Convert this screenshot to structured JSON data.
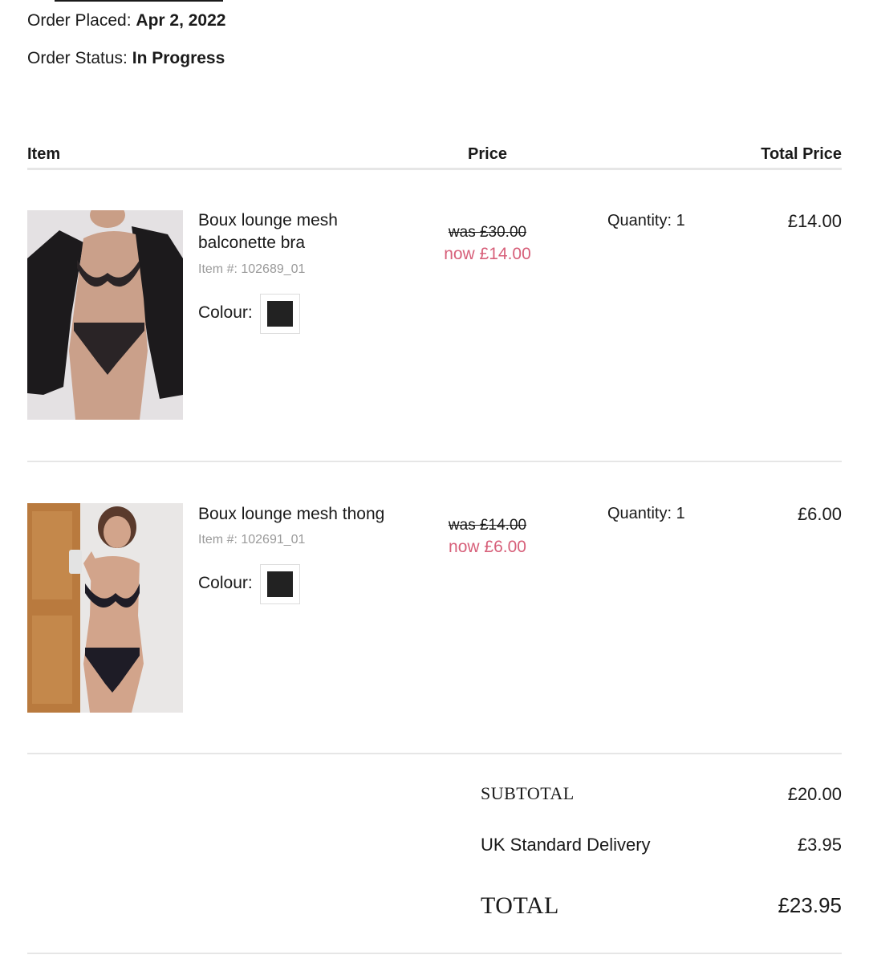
{
  "order": {
    "placed_label": "Order Placed:",
    "placed_value": "Apr 2, 2022",
    "status_label": "Order Status:",
    "status_value": "In Progress"
  },
  "table_header": {
    "item": "Item",
    "price": "Price",
    "total_price": "Total Price"
  },
  "items": [
    {
      "name": "Boux lounge mesh balconette bra",
      "item_number": "Item #: 102689_01",
      "colour_label": "Colour:",
      "colour_swatch": "#222222",
      "was_price": "was £30.00",
      "now_price": "now £14.00",
      "quantity": "Quantity: 1",
      "total": "£14.00"
    },
    {
      "name": "Boux lounge mesh thong",
      "item_number": "Item #: 102691_01",
      "colour_label": "Colour:",
      "colour_swatch": "#222222",
      "was_price": "was £14.00",
      "now_price": "now £6.00",
      "quantity": "Quantity: 1",
      "total": "£6.00"
    }
  ],
  "summary": {
    "subtotal_label": "SUBTOTAL",
    "subtotal_value": "£20.00",
    "delivery_label": "UK Standard Delivery",
    "delivery_value": "£3.95",
    "total_label": "TOTAL",
    "total_value": "£23.95"
  },
  "colors": {
    "sale_price": "#d7607a",
    "divider": "#e6e6e6",
    "muted_text": "#9a9a9a"
  }
}
